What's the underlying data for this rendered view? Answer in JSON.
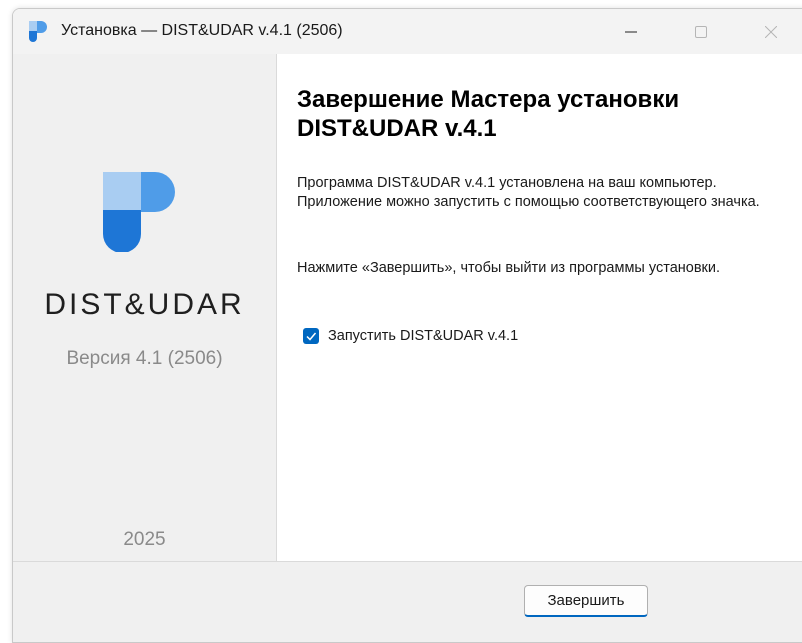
{
  "window": {
    "title": "Установка — DIST&UDAR v.4.1 (2506)",
    "controls": {
      "minimize_icon": "minimize-icon",
      "maximize_icon": "maximize-icon",
      "close_icon": "close-icon"
    }
  },
  "sidebar": {
    "logo_icon": "dist-udar-logo-icon",
    "brand_name": "DIST&UDAR",
    "version": "Версия 4.1 (2506)",
    "year": "2025"
  },
  "content": {
    "heading": "Завершение Мастера установки DIST&UDAR v.4.1",
    "paragraph1": "Программа DIST&UDAR v.4.1 установлена на ваш компьютер. Приложение можно запустить с помощью соответствующего значка.",
    "paragraph2": "Нажмите «Завершить», чтобы выйти из программы установки.",
    "launch_checkbox": {
      "label": "Запустить DIST&UDAR v.4.1",
      "checked": true
    }
  },
  "footer": {
    "finish_label": "Завершить"
  },
  "colors": {
    "accent": "#0067c0",
    "logo_dark_blue": "#1e76d6",
    "logo_mid_blue": "#4f9ce8",
    "logo_light_blue": "#a9cdf2",
    "sidebar_bg": "#f0f0f0",
    "muted_text": "#8a8a8a"
  }
}
